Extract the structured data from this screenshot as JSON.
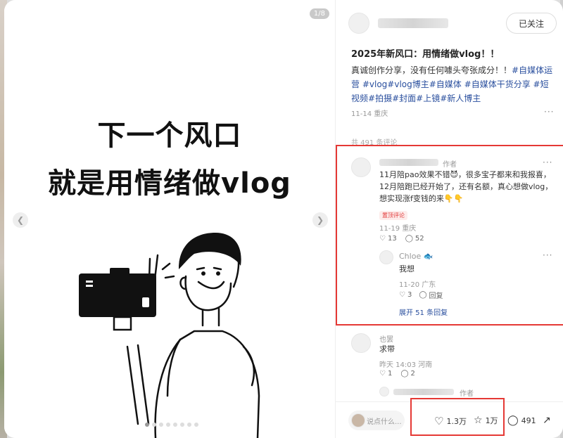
{
  "image": {
    "counter": "1/8",
    "headline_line1": "下一个风口",
    "headline_line2": "就是用情绪做vlog",
    "prev_icon": "chevron-left-icon",
    "next_icon": "chevron-right-icon",
    "dot_count": 8,
    "active_dot": 1
  },
  "author": {
    "follow_label": "已关注"
  },
  "post": {
    "title": "2025年新风口：用情绪做vlog！！",
    "body_text": "真诚创作分享，没有任何噱头夸张成分！！",
    "tags": [
      "#自媒体运营",
      "#vlog",
      "#vlog博主",
      "#自媒体",
      "#自媒体干货分享",
      "#短视频",
      "#拍摄",
      "#封面",
      "#上镜",
      "#新人博主"
    ],
    "date_location": "11-14 重庆",
    "comment_count_label": "共 491 条评论"
  },
  "comments": [
    {
      "badge": "作者",
      "text": "11月陪pao效果不错😈，很多宝子都来和我报喜，12月陪跑已经开始了，还有名额，真心想做vlog，想实现涨f变钱的来👇👇",
      "pinned_label": "置顶评论",
      "date_location": "11-19 重庆",
      "likes": "13",
      "replies": "52",
      "reply": {
        "name": "Chloe",
        "name_emoji": "🐟",
        "text": "我想",
        "date_location": "11-20 广东",
        "likes": "3",
        "reply_label": "回复"
      },
      "expand_label": "展开 51 条回复"
    },
    {
      "name": "也罢",
      "text": "求带",
      "date_location": "昨天 14:03 河南",
      "likes": "1",
      "replies": "2"
    },
    {
      "badge": "作者"
    }
  ],
  "bottom": {
    "input_placeholder": "说点什么...",
    "likes": "1.3万",
    "collects": "1万",
    "comments": "491"
  },
  "colors": {
    "highlight_red": "#e53935",
    "tag_blue": "#2a4f9e",
    "pin_red": "#e23b3b"
  }
}
